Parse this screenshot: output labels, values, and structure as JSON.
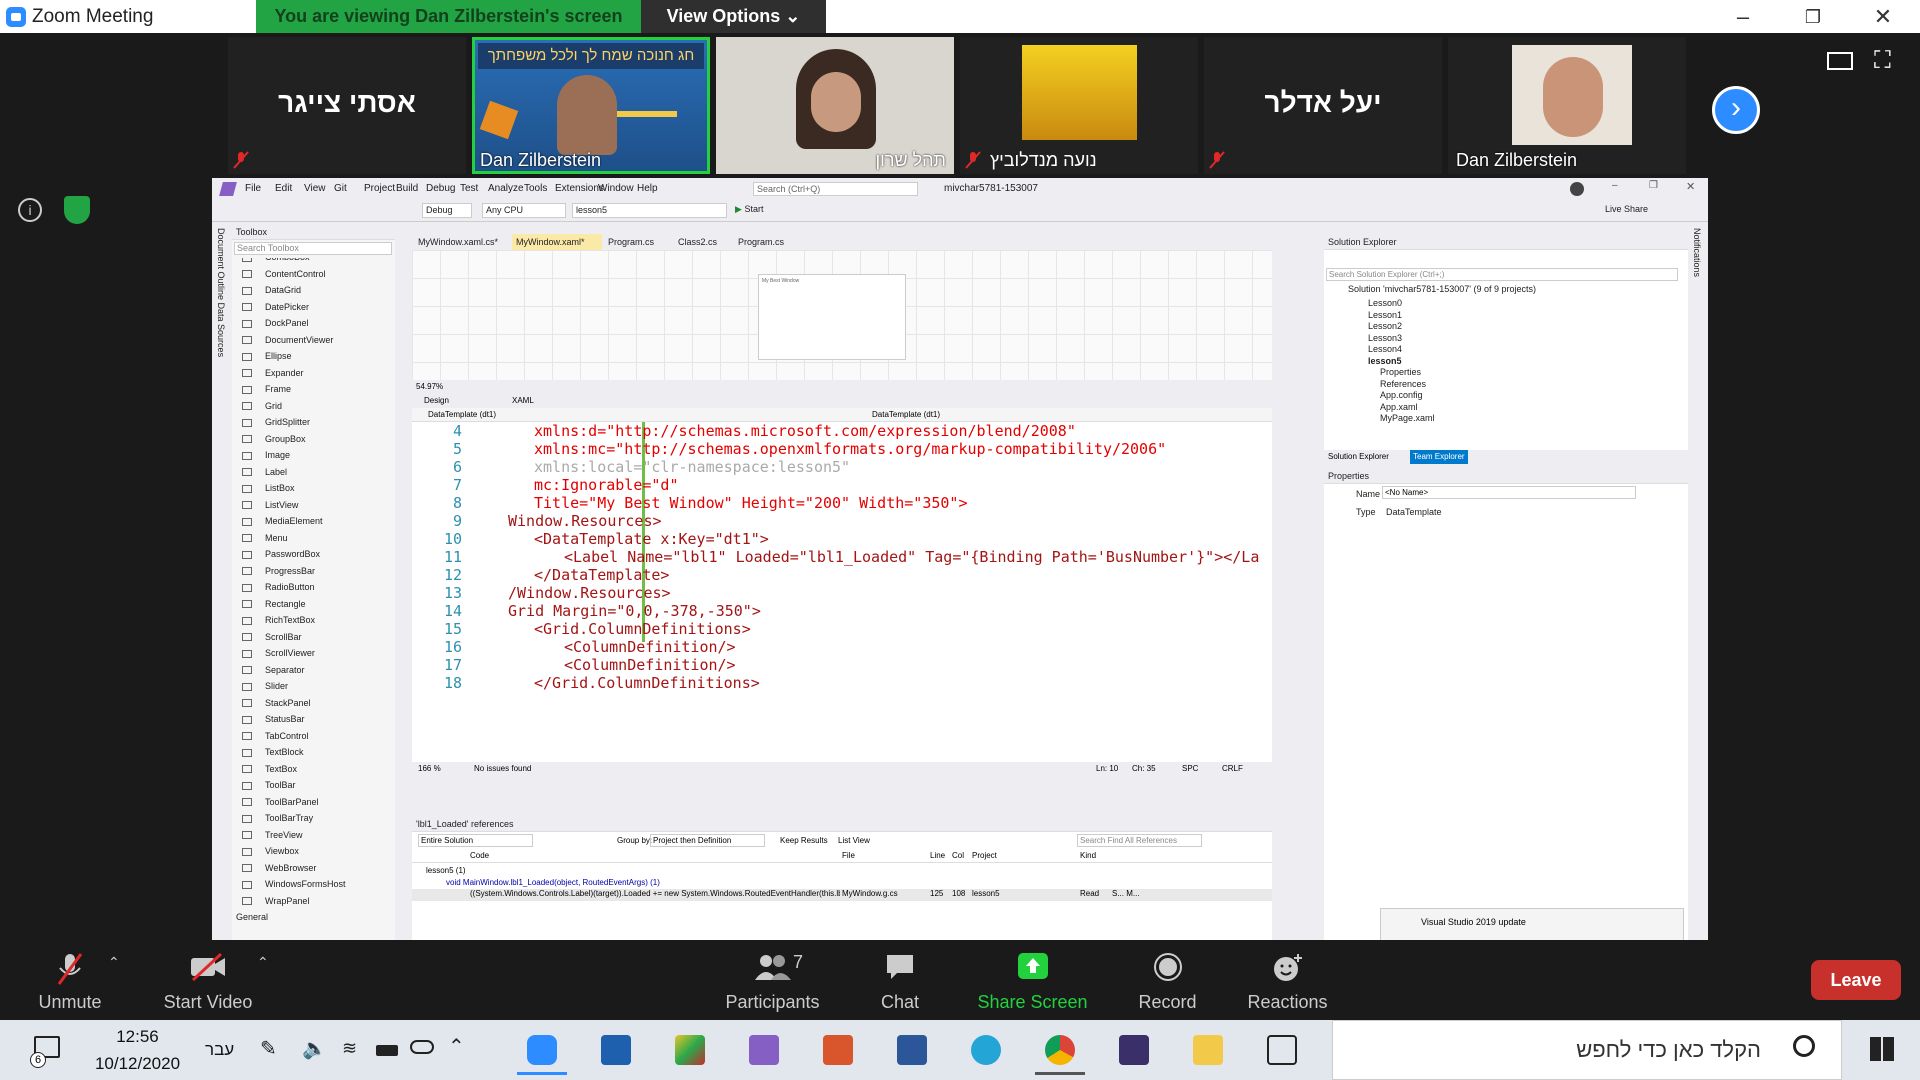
{
  "window": {
    "title": "Zoom Meeting",
    "viewing_banner": "You are viewing Dan Zilberstein's screen",
    "view_options": "View Options"
  },
  "gallery": {
    "tiles": [
      {
        "name": "אסתי צייגר",
        "type": "name-only",
        "muted": true
      },
      {
        "name": "Dan Zilberstein",
        "type": "video",
        "active": true
      },
      {
        "name": "תהל שרון",
        "type": "video"
      },
      {
        "name": "נועה מנדלוביץ",
        "type": "video",
        "muted": true
      },
      {
        "name": "יעל אדלר",
        "type": "name-only",
        "muted": true
      },
      {
        "name": "Dan Zilberstein",
        "type": "video"
      }
    ],
    "banner_text": "חג חנוכה שמח לך ולכל משפחתך"
  },
  "vs": {
    "menu": [
      "File",
      "Edit",
      "View",
      "Git",
      "Project",
      "Build",
      "Debug",
      "Test",
      "Analyze",
      "Tools",
      "Extensions",
      "Window",
      "Help"
    ],
    "search": "Search (Ctrl+Q)",
    "solution_name": "mivchar5781-153007",
    "toolbar": {
      "config": "Debug",
      "platform": "Any CPU",
      "startup": "lesson5",
      "start": "Start"
    },
    "live_share": "Live Share",
    "toolbox": {
      "title": "Toolbox",
      "search": "Search Toolbox",
      "items": [
        "ComboBox",
        "ContentControl",
        "DataGrid",
        "DatePicker",
        "DockPanel",
        "DocumentViewer",
        "Ellipse",
        "Expander",
        "Frame",
        "Grid",
        "GridSplitter",
        "GroupBox",
        "Image",
        "Label",
        "ListBox",
        "ListView",
        "MediaElement",
        "Menu",
        "PasswordBox",
        "ProgressBar",
        "RadioButton",
        "Rectangle",
        "RichTextBox",
        "ScrollBar",
        "ScrollViewer",
        "Separator",
        "Slider",
        "StackPanel",
        "StatusBar",
        "TabControl",
        "TextBlock",
        "TextBox",
        "ToolBar",
        "ToolBarPanel",
        "ToolBarTray",
        "TreeView",
        "Viewbox",
        "WebBrowser",
        "WindowsFormsHost",
        "WrapPanel"
      ],
      "general": "General"
    },
    "side_tabs": "Document Outline   Data Sources",
    "tabs": [
      "MyWindow.xaml.cs*",
      "MyWindow.xaml*",
      "Program.cs",
      "Class2.cs",
      "Program.cs"
    ],
    "designer": {
      "zoom": "54.97%",
      "design_tab": "Design",
      "xaml_tab": "XAML",
      "window_title": "My Best Window"
    },
    "breadcrumb_left": "DataTemplate (dt1)",
    "breadcrumb_right": "DataTemplate (dt1)",
    "code_lines": [
      {
        "n": "4",
        "text": "xmlns:d=\"http://schemas.microsoft.com/expression/blend/2008\""
      },
      {
        "n": "5",
        "text": "xmlns:mc=\"http://schemas.openxmlformats.org/markup-compatibility/2006\""
      },
      {
        "n": "6",
        "text": "xmlns:local=\"clr-namespace:lesson5\""
      },
      {
        "n": "7",
        "text": "mc:Ignorable=\"d\""
      },
      {
        "n": "8",
        "text": "Title=\"My Best Window\" Height=\"200\" Width=\"350\">"
      },
      {
        "n": "9",
        "text": "Window.Resources>"
      },
      {
        "n": "10",
        "text": "<DataTemplate x:Key=\"dt1\">"
      },
      {
        "n": "11",
        "text": "<Label Name=\"lbl1\" Loaded=\"lbl1_Loaded\" Tag=\"{Binding Path='BusNumber'}\"></La"
      },
      {
        "n": "12",
        "text": "</DataTemplate>"
      },
      {
        "n": "13",
        "text": "/Window.Resources>"
      },
      {
        "n": "14",
        "text": "Grid Margin=\"0,0,-378,-350\">"
      },
      {
        "n": "15",
        "text": "<Grid.ColumnDefinitions>"
      },
      {
        "n": "16",
        "text": "<ColumnDefinition/>"
      },
      {
        "n": "17",
        "text": "<ColumnDefinition/>"
      },
      {
        "n": "18",
        "text": "</Grid.ColumnDefinitions>"
      }
    ],
    "editor_status": {
      "zoom": "166 %",
      "issues": "No issues found",
      "ln": "Ln: 10",
      "ch": "Ch: 35",
      "spc": "SPC",
      "crlf": "CRLF"
    },
    "refs": {
      "title": "'lbl1_Loaded' references",
      "scope": "Entire Solution",
      "group_by_label": "Group by:",
      "group_by": "Project then Definition",
      "keep": "Keep Results",
      "list_view": "List View",
      "search": "Search Find All References",
      "columns": [
        "Code",
        "File",
        "Line",
        "Col",
        "Project",
        "Kind"
      ],
      "group": "lesson5 (1)",
      "method": "void MainWindow.lbl1_Loaded(object, RoutedEventArgs) (1)",
      "row": {
        "code": "((System.Windows.Controls.Label)(target)).Loaded += new System.Windows.RoutedEventHandler(this.lbl...",
        "file": "MyWindow.g.cs",
        "line": "125",
        "col": "108",
        "project": "lesson5",
        "kind": "Read",
        "extra": "S... M..."
      }
    },
    "solution_explorer": {
      "title": "Solution Explorer",
      "search": "Search Solution Explorer (Ctrl+;)",
      "solution": "Solution 'mivchar5781-153007' (9 of 9 projects)",
      "projects": [
        "Lesson0",
        "Lesson1",
        "Lesson2",
        "Lesson3",
        "Lesson4",
        "lesson5"
      ],
      "lesson5_children": [
        "Properties",
        "References",
        "App.config",
        "App.xaml",
        "MyPage.xaml"
      ],
      "tabs": [
        "Solution Explorer",
        "Team Explorer"
      ]
    },
    "properties": {
      "title": "Properties",
      "name_label": "Name",
      "name_value": "<No Name>",
      "type_label": "Type",
      "type_value": "DataTemplate"
    },
    "notification": "Visual Studio 2019 update",
    "notifications_tab": "Notifications"
  },
  "controls": {
    "unmute": "Unmute",
    "start_video": "Start Video",
    "participants": "Participants",
    "participants_count": "7",
    "chat": "Chat",
    "share_screen": "Share Screen",
    "record": "Record",
    "reactions": "Reactions",
    "leave": "Leave"
  },
  "taskbar": {
    "time": "12:56",
    "date": "10/12/2020",
    "lang": "עבר",
    "notif_count": "6",
    "search": "הקלד כאן כדי לחפש"
  }
}
